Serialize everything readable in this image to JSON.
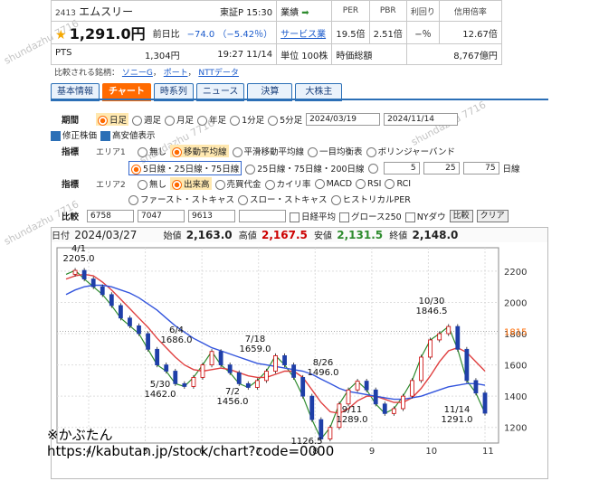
{
  "quote": {
    "code": "2413",
    "name": "エムスリー",
    "market": "東証P",
    "time": "15:30",
    "price": "1,291.0円",
    "prev_label": "前日比",
    "change": "−74.0",
    "change_pct": "（−5.42％）",
    "results_label": "業績",
    "sector": "サービス業",
    "unit": "単位 100株",
    "pts_label": "PTS",
    "pts_price": "1,304円",
    "pts_time": "19:27 11/14",
    "per_label": "PER",
    "per": "19.5倍",
    "pbr_label": "PBR",
    "pbr": "2.51倍",
    "yield_label": "利回り",
    "yield": "−％",
    "margin_label": "信用倍率",
    "margin": "12.67倍",
    "mcap_label": "時価総額",
    "mcap": "8,767億円",
    "compare_label": "比較される銘柄",
    "compare": [
      "ソニーG",
      "ポート",
      "NTTデータ"
    ]
  },
  "tabs": [
    "基本情報",
    "チャート",
    "時系列",
    "ニュース",
    "決算",
    "大株主"
  ],
  "controls": {
    "period_label": "期間",
    "periods": [
      "日足",
      "週足",
      "月足",
      "年足",
      "1分足",
      "5分足"
    ],
    "date_from": "2024/03/19",
    "date_to": "2024/11/14",
    "adjust": "修正株価",
    "highlow": "高安値表示",
    "ind_label": "指標",
    "area1": "エリア1",
    "area2": "エリア2",
    "a1_opts": [
      "無し",
      "移動平均線",
      "平滑移動平均線",
      "一目均衡表",
      "ボリンジャーバンド"
    ],
    "ma_opts": [
      "5日線・25日線・75日線",
      "25日線・75日線・200日線"
    ],
    "ma_vals": [
      "5",
      "25",
      "75"
    ],
    "ma_unit": "日線",
    "a2_opts": [
      "無し",
      "出来高",
      "売買代金",
      "カイリ率",
      "MACD",
      "RSI",
      "RCI"
    ],
    "a2_opts2": [
      "ファースト・ストキャス",
      "スロー・ストキャス",
      "ヒストリカルPER"
    ],
    "cmp_label": "比較",
    "cmp_vals": [
      "6758",
      "7047",
      "9613",
      ""
    ],
    "cmp_checks": [
      "日経平均",
      "グロース250",
      "NYダウ"
    ],
    "btn_compare": "比較",
    "btn_clear": "クリア"
  },
  "ohlc": {
    "date_label": "日付",
    "date": "2024/03/27",
    "open_label": "始値",
    "open": "2,163.0",
    "high_label": "高値",
    "high": "2,167.5",
    "low_label": "安値",
    "low": "2,131.5",
    "close_label": "終値",
    "close": "2,148.0"
  },
  "chart_data": {
    "type": "line",
    "x_ticks": [
      "4",
      "5",
      "6",
      "7",
      "8",
      "9",
      "10",
      "11"
    ],
    "y_ticks": [
      2200,
      2000,
      1800,
      1600,
      1400,
      1200
    ],
    "ylim": [
      1100,
      2350
    ],
    "current_price_label": "1815",
    "annotations": [
      {
        "text": "4/1",
        "value": "2205.0"
      },
      {
        "text": "6/4",
        "value": "1686.0"
      },
      {
        "text": "5/30",
        "value": "1462.0"
      },
      {
        "text": "7/18",
        "value": "1659.0"
      },
      {
        "text": "7/2",
        "value": "1456.0"
      },
      {
        "text": "8/26",
        "value": "1496.0"
      },
      {
        "text": "10/30",
        "value": "1846.5"
      },
      {
        "text": "9/11",
        "value": "1289.0"
      },
      {
        "text": "11/14",
        "value": "1291.0"
      },
      {
        "text": "",
        "value": "1126.5"
      }
    ],
    "series": [
      {
        "values": [
          2180,
          2205,
          2150,
          2100,
          2050,
          1980,
          1900,
          1850,
          1800,
          1700,
          1600,
          1560,
          1480,
          1462,
          1520,
          1600,
          1686,
          1600,
          1550,
          1480,
          1456,
          1500,
          1560,
          1659,
          1600,
          1520,
          1400,
          1250,
          1126,
          1200,
          1350,
          1440,
          1496,
          1440,
          1350,
          1289,
          1320,
          1400,
          1500,
          1650,
          1760,
          1800,
          1846,
          1700,
          1500,
          1420,
          1291
        ]
      },
      {
        "values": [
          2150,
          2170,
          2180,
          2170,
          2130,
          2080,
          2020,
          1960,
          1900,
          1840,
          1770,
          1710,
          1650,
          1600,
          1570,
          1560,
          1570,
          1580,
          1570,
          1550,
          1530,
          1520,
          1520,
          1540,
          1560,
          1560,
          1520,
          1440,
          1360,
          1300,
          1290,
          1320,
          1370,
          1400,
          1400,
          1380,
          1360,
          1360,
          1390,
          1450,
          1530,
          1620,
          1690,
          1710,
          1680,
          1620,
          1560
        ]
      },
      {
        "values": [
          2050,
          2080,
          2100,
          2110,
          2110,
          2100,
          2080,
          2060,
          2030,
          1990,
          1950,
          1900,
          1850,
          1810,
          1770,
          1740,
          1710,
          1690,
          1670,
          1650,
          1630,
          1610,
          1600,
          1590,
          1580,
          1570,
          1560,
          1540,
          1510,
          1480,
          1450,
          1430,
          1420,
          1410,
          1400,
          1390,
          1380,
          1380,
          1390,
          1400,
          1420,
          1440,
          1460,
          1470,
          1480,
          1480,
          1470
        ]
      }
    ]
  },
  "footer": {
    "line1": "※かぶたん",
    "line2": "https://kabutan.jp/stock/chart?code=0000"
  },
  "colors": {
    "accent": "#ff6a00",
    "up": "#cc0000",
    "down": "#1a5acb",
    "ma5": "#2e8b2e",
    "ma25": "#e04040",
    "ma75": "#3355dd"
  }
}
